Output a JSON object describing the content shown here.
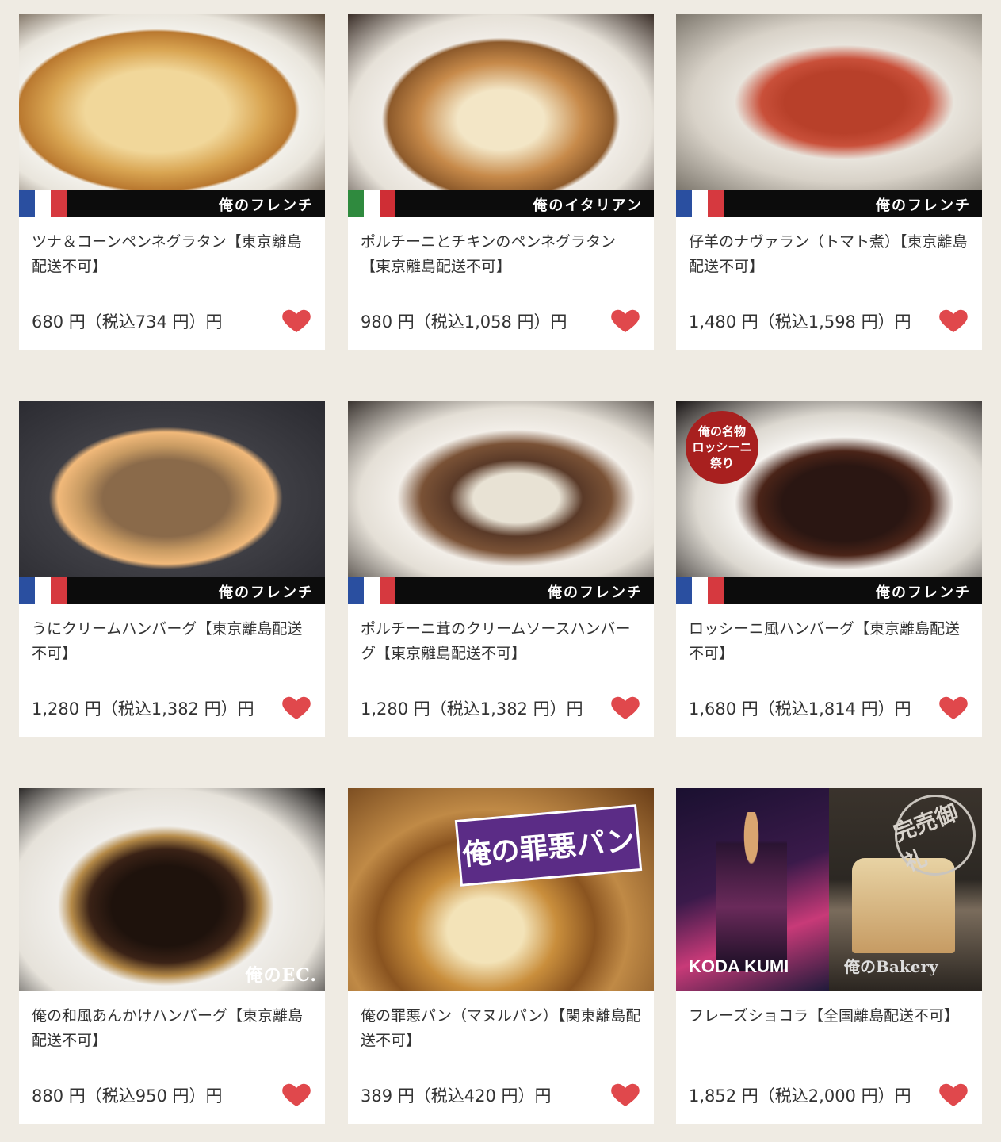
{
  "products": [
    {
      "name": "ツナ＆コーンペンネグラタン【東京離島配送不可】",
      "price": "680 円（税込734 円）円",
      "brand": "俺のフレンチ",
      "flag": "france",
      "image": "gratin"
    },
    {
      "name": "ポルチーニとチキンのペンネグラタン【東京離島配送不可】",
      "price": "980 円（税込1,058 円）円",
      "brand": "俺のイタリアン",
      "flag": "italy",
      "image": "gratin2"
    },
    {
      "name": "仔羊のナヴァラン（トマト煮）【東京離島配送不可】",
      "price": "1,480 円（税込1,598 円）円",
      "brand": "俺のフレンチ",
      "flag": "france",
      "image": "stew"
    },
    {
      "name": "うにクリームハンバーグ【東京離島配送不可】",
      "price": "1,280 円（税込1,382 円）円",
      "brand": "俺のフレンチ",
      "flag": "france",
      "image": "hamburg-cream"
    },
    {
      "name": "ポルチーニ茸のクリームソースハンバーグ【東京離島配送不可】",
      "price": "1,280 円（税込1,382 円）円",
      "brand": "俺のフレンチ",
      "flag": "france",
      "image": "hamburg-white"
    },
    {
      "name": "ロッシーニ風ハンバーグ【東京離島配送不可】",
      "price": "1,680 円（税込1,814 円）円",
      "brand": "俺のフレンチ",
      "flag": "france",
      "image": "hamburg-dark",
      "badge": [
        "俺の名物",
        "ロッシーニ",
        "祭り"
      ]
    },
    {
      "name": "俺の和風あんかけハンバーグ【東京離島配送不可】",
      "price": "880 円（税込950 円）円",
      "brand": "俺のEC.",
      "flag": "none",
      "image": "hamburg-ankake"
    },
    {
      "name": "俺の罪悪パン（マヌルパン）【関東離島配送不可】",
      "price": "389 円（税込420 円）円",
      "brand": "",
      "flag": "none",
      "image": "bread",
      "banner": "俺の罪悪パン"
    },
    {
      "name": "フレーズショコラ【全国離島配送不可】",
      "price": "1,852 円（税込2,000 円）円",
      "brand": "",
      "flag": "none",
      "image": "koda",
      "left_caption": "KODA KUMI",
      "right_caption": "俺のBakery",
      "soldout": "完売御礼"
    }
  ],
  "colors": {
    "heart": "#e0484c",
    "background": "#efebe3",
    "france_blue": "#2a4fa0",
    "france_red": "#d6393f",
    "italy_green": "#2f8a3e",
    "italy_red": "#cf2e35"
  }
}
